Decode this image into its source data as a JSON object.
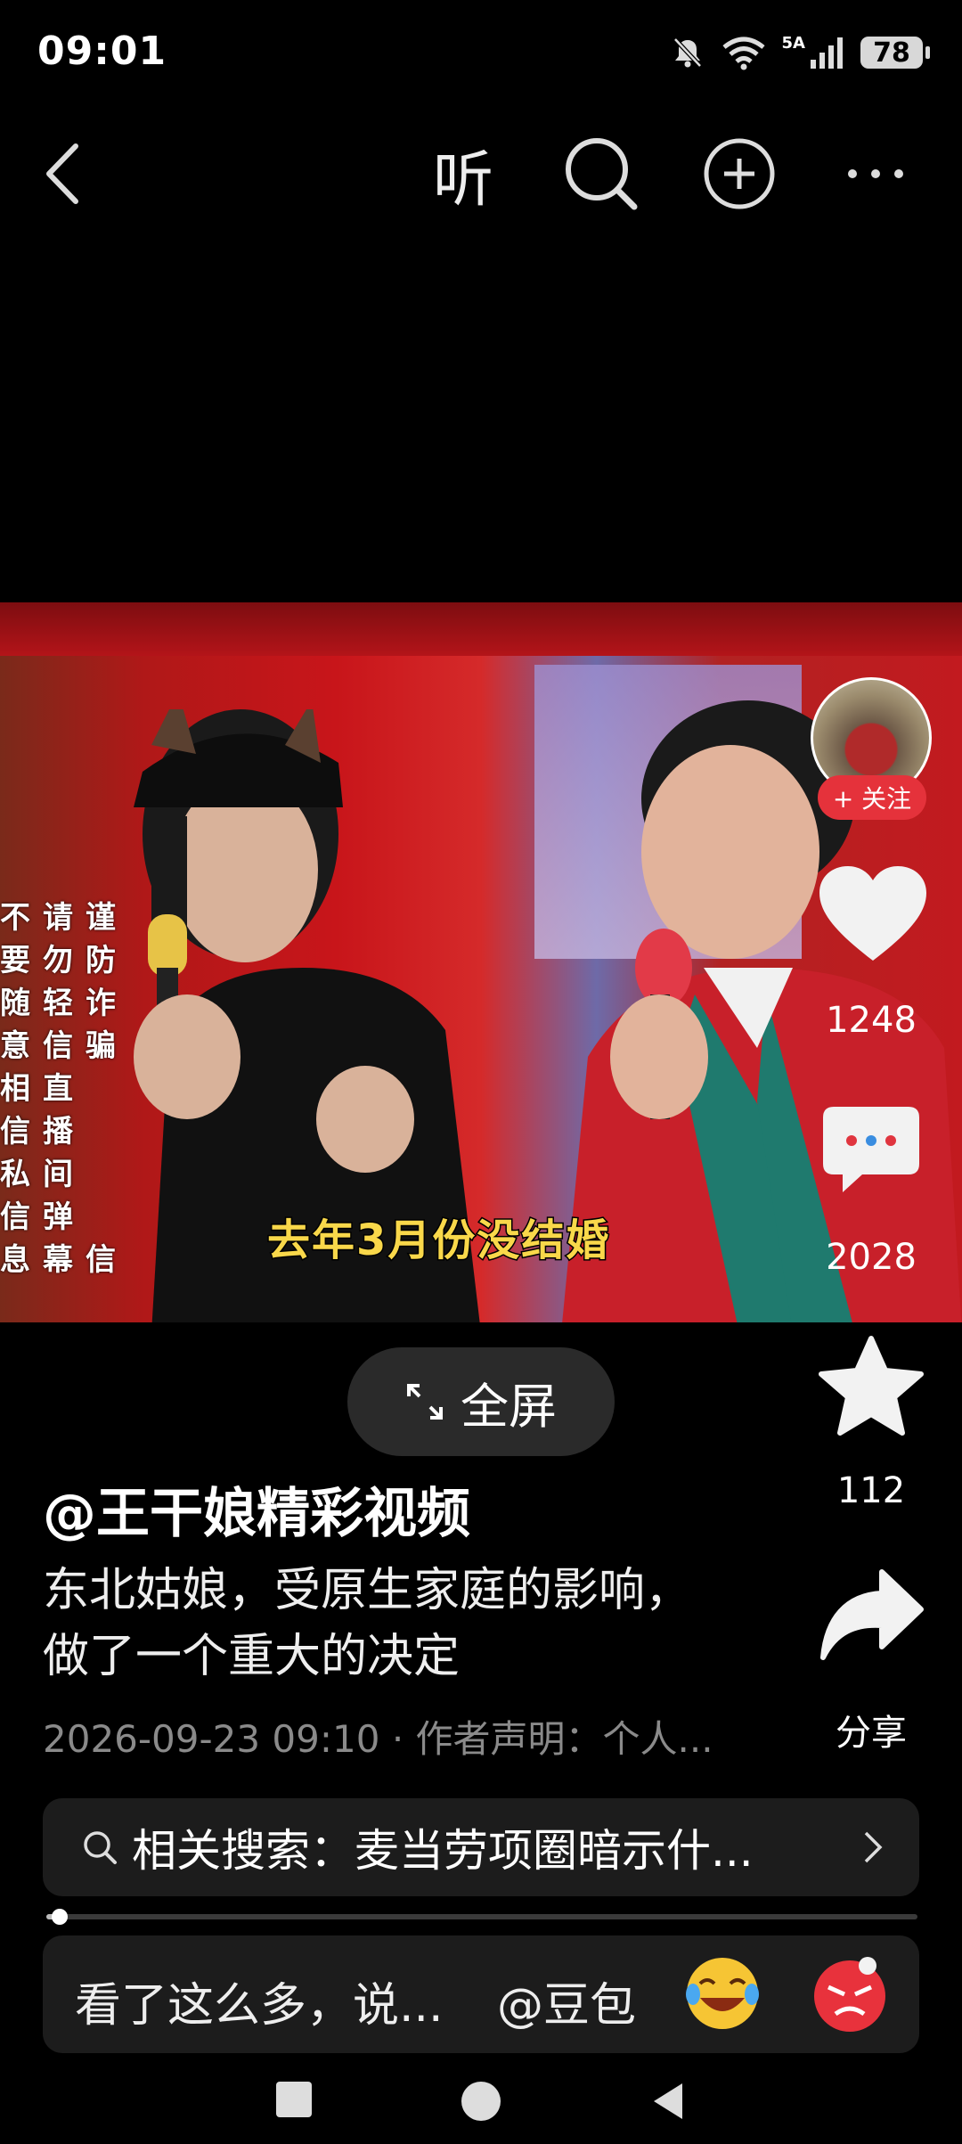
{
  "status_bar": {
    "time": "09:01",
    "network_label": "5A",
    "battery": "78"
  },
  "top_bar": {
    "listen_label": "听"
  },
  "video": {
    "subtitle": "去年3月份没结婚",
    "warning_columns": [
      [
        "不",
        "要",
        "随",
        "意",
        "相",
        "信",
        "私",
        "信",
        "息"
      ],
      [
        "请",
        "勿",
        "轻",
        "信",
        "直",
        "播",
        "间",
        "弹",
        "幕"
      ],
      [
        "谨",
        "防",
        "诈",
        "骗",
        "",
        "",
        "",
        "",
        "信"
      ]
    ]
  },
  "right_rail": {
    "follow_label": "+ 关注",
    "likes": "1248",
    "comments": "2028",
    "favorites": "112",
    "share_label": "分享"
  },
  "fullscreen_label": "全屏",
  "post": {
    "author": "@王干娘精彩视频",
    "caption_line1": "东北姑娘，受原生家庭的影响，",
    "caption_line2": "做了一个重大的决定",
    "meta": "2026-09-23 09:10 · 作者声明：个人..."
  },
  "related_search": {
    "text": "相关搜索：麦当劳项圈暗示什..."
  },
  "progress": {
    "fraction": 0.015
  },
  "comment_bar": {
    "placeholder": "看了这么多，说...",
    "mention": "@豆包"
  }
}
